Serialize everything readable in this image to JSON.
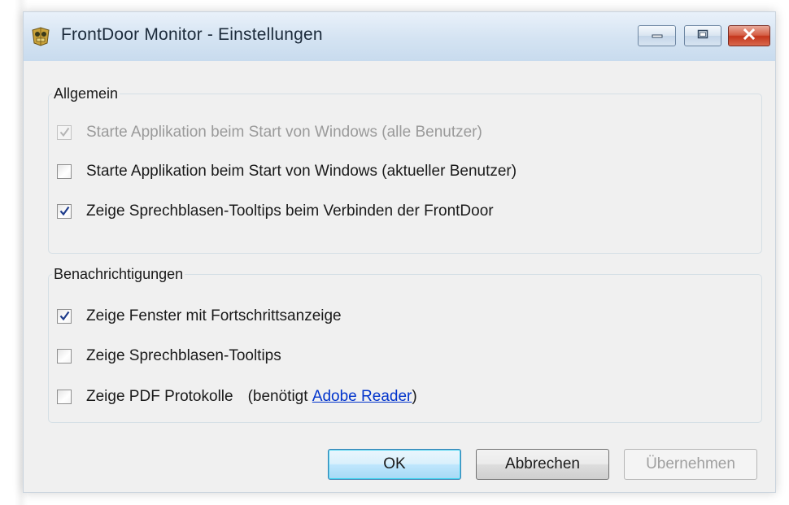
{
  "window": {
    "title": "FrontDoor Monitor - Einstellungen"
  },
  "groups": {
    "general": {
      "legend": "Allgemein",
      "options": [
        {
          "label": "Starte Applikation beim Start von Windows (alle Benutzer)",
          "checked": true,
          "enabled": false
        },
        {
          "label": "Starte Applikation beim Start von Windows (aktueller Benutzer)",
          "checked": false,
          "enabled": true
        },
        {
          "label": "Zeige Sprechblasen-Tooltips beim Verbinden der FrontDoor",
          "checked": true,
          "enabled": true
        }
      ]
    },
    "notifications": {
      "legend": "Benachrichtigungen",
      "options": [
        {
          "label": "Zeige Fenster mit Fortschrittsanzeige",
          "checked": true,
          "enabled": true
        },
        {
          "label": "Zeige Sprechblasen-Tooltips",
          "checked": false,
          "enabled": true
        },
        {
          "label": "Zeige PDF Protokolle",
          "checked": false,
          "enabled": true
        }
      ],
      "pdf_hint_prefix": "(benötigt ",
      "pdf_hint_link": "Adobe Reader",
      "pdf_hint_suffix": ")"
    }
  },
  "buttons": {
    "ok": "OK",
    "cancel": "Abbrechen",
    "apply": "Übernehmen"
  },
  "colors": {
    "titlebar": "#d4e3f2",
    "close_button": "#c4351b",
    "link": "#0033cc",
    "default_button_border": "#3c7fb1"
  }
}
